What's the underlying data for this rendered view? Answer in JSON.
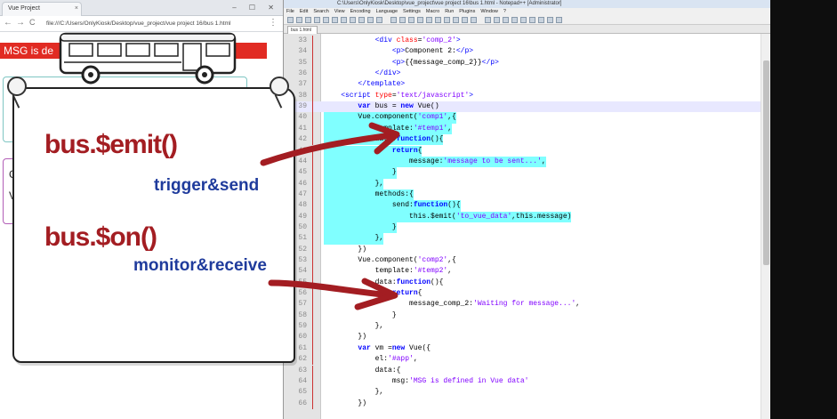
{
  "browser": {
    "tab_title": "Vue Project",
    "tab_close": "×",
    "window_controls": "– ☐ ✕",
    "back": "←",
    "forward": "→",
    "reload": "C",
    "url": "file:///C:/Users/OnlyKiosk/Desktop/vue_project/vue project 16/bus 1.html",
    "menu": "⋮",
    "msg_bar_text": "MSG is de",
    "card2_peek_1": "C",
    "card2_peek_2": "V"
  },
  "paper": {
    "emit_label": "bus.$emit()",
    "emit_desc": "trigger&send",
    "on_label": "bus.$on()",
    "on_desc": "monitor&receive"
  },
  "notepad": {
    "title": "C:\\Users\\OnlyKiosk\\Desktop\\vue_project\\vue project 16\\bus 1.html - Notepad++ [Administrator]",
    "menu": [
      "File",
      "Edit",
      "Search",
      "View",
      "Encoding",
      "Language",
      "Settings",
      "Macro",
      "Run",
      "Plugins",
      "Window",
      "?"
    ],
    "tab": "bus 1.html",
    "lines": [
      {
        "n": "33",
        "text": "            <div class='comp_2'>",
        "hl": false
      },
      {
        "n": "34",
        "text": "                <p>Component 2:</p>",
        "hl": false
      },
      {
        "n": "35",
        "text": "                <p>{{message_comp_2}}</p>",
        "hl": false
      },
      {
        "n": "36",
        "text": "            </div>",
        "hl": false
      },
      {
        "n": "37",
        "text": "        </template>",
        "hl": false
      },
      {
        "n": "38",
        "text": "    <script type='text/javascript'>",
        "hl": false
      },
      {
        "n": "39",
        "text": "        var bus = new Vue()",
        "hl": false,
        "cur": true
      },
      {
        "n": "40",
        "text": "        Vue.component('comp1',{",
        "hl": true
      },
      {
        "n": "41",
        "text": "            template:'#temp1',",
        "hl": true
      },
      {
        "n": "42",
        "text": "            data:function(){",
        "hl": true
      },
      {
        "n": "43",
        "text": "                return{",
        "hl": true
      },
      {
        "n": "44",
        "text": "                    message:'message to be sent...',",
        "hl": true
      },
      {
        "n": "45",
        "text": "                }",
        "hl": true
      },
      {
        "n": "46",
        "text": "            },",
        "hl": true
      },
      {
        "n": "47",
        "text": "            methods:{",
        "hl": true
      },
      {
        "n": "48",
        "text": "                send:function(){",
        "hl": true
      },
      {
        "n": "49",
        "text": "                    this.$emit('to_vue_data',this.message)",
        "hl": true
      },
      {
        "n": "50",
        "text": "                }",
        "hl": true
      },
      {
        "n": "51",
        "text": "            },",
        "hl": true
      },
      {
        "n": "52",
        "text": "        })",
        "hl": false
      },
      {
        "n": "53",
        "text": "        Vue.component('comp2',{",
        "hl": false
      },
      {
        "n": "54",
        "text": "            template:'#temp2',",
        "hl": false
      },
      {
        "n": "55",
        "text": "            data:function(){",
        "hl": false
      },
      {
        "n": "56",
        "text": "                return{",
        "hl": false
      },
      {
        "n": "57",
        "text": "                    message_comp_2:'Waiting for message...',",
        "hl": false
      },
      {
        "n": "58",
        "text": "                }",
        "hl": false
      },
      {
        "n": "59",
        "text": "            },",
        "hl": false
      },
      {
        "n": "60",
        "text": "        })",
        "hl": false
      },
      {
        "n": "61",
        "text": "        var vm =new Vue({",
        "hl": false
      },
      {
        "n": "62",
        "text": "            el:'#app',",
        "hl": false
      },
      {
        "n": "63",
        "text": "            data:{",
        "hl": false
      },
      {
        "n": "64",
        "text": "                msg:'MSG is defined in Vue data'",
        "hl": false
      },
      {
        "n": "65",
        "text": "            },",
        "hl": false
      },
      {
        "n": "66",
        "text": "        })",
        "hl": false
      }
    ]
  },
  "colors": {
    "msg_bar": "#e12b23",
    "emit_color": "#a31d22",
    "desc_color": "#1f3b9c",
    "arrow_color": "#a31d22",
    "highlight": "#80ffff"
  }
}
